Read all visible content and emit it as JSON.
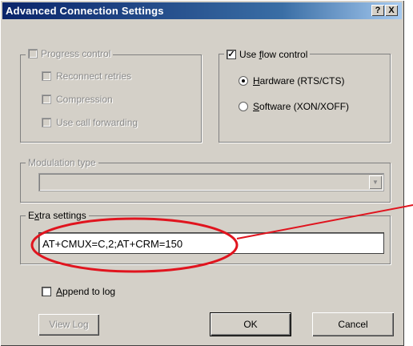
{
  "window": {
    "title": "Advanced Connection Settings",
    "help_button": "?",
    "close_button": "X"
  },
  "progress_control": {
    "label": "Progress control",
    "items": [
      {
        "label": "Reconnect retries",
        "checked": false
      },
      {
        "label": "Compression",
        "checked": false
      },
      {
        "label": "Use call forwarding",
        "checked": false
      }
    ]
  },
  "flow_control": {
    "label": "Use flow control",
    "checked": true,
    "options": [
      {
        "mnemonic": "H",
        "rest": "ardware (RTS/CTS)",
        "selected": true
      },
      {
        "mnemonic": "S",
        "rest": "oftware (XON/XOFF)",
        "selected": false
      }
    ]
  },
  "modulation": {
    "label": "Modulation type",
    "value": ""
  },
  "extra_settings": {
    "label": "Extra settings",
    "value": "AT+CMUX=C,2;AT+CRM=150"
  },
  "append_to_log": {
    "mnemonic": "A",
    "rest": "ppend to log",
    "checked": false
  },
  "buttons": {
    "view_log": "View Log",
    "ok": "OK",
    "cancel": "Cancel"
  },
  "annotation": {
    "color": "#e0141e"
  }
}
